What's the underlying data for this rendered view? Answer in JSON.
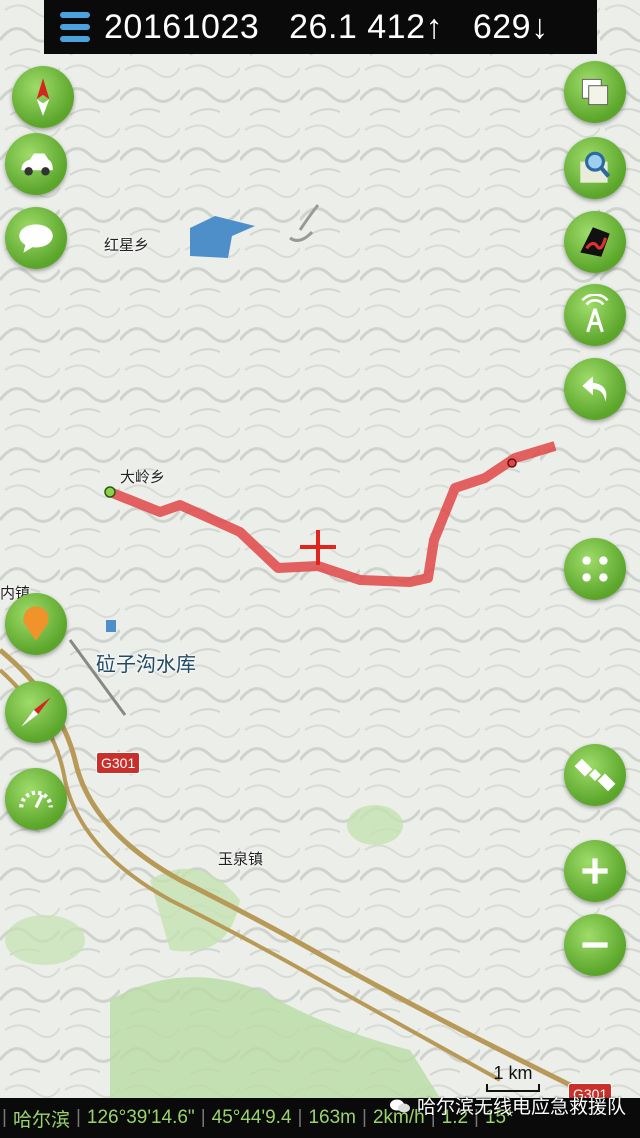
{
  "header": {
    "date": "20161023",
    "distance": "26.1",
    "ascent": "412",
    "descent": "629",
    "up_arrow": "↑",
    "down_arrow": "↓"
  },
  "map": {
    "places": {
      "hongxing": "红星乡",
      "daling": "大岭乡",
      "reservoir": "砬子沟水库",
      "yuquan": "玉泉镇",
      "left_edge_town": "内镇"
    },
    "road_g301": "G301",
    "road_g301_right": "G301",
    "scale_label": "1 km"
  },
  "controls": {
    "left": [
      "compass-icon",
      "car-icon",
      "chat-icon",
      "location-pin-icon",
      "compass-small-icon",
      "speedometer-icon"
    ],
    "right": [
      "layers-icon",
      "map-search-icon",
      "track-icon",
      "signal-tower-icon",
      "undo-icon",
      "dots-menu-icon",
      "satellite-icon",
      "zoom-in-icon",
      "zoom-out-icon"
    ]
  },
  "status": {
    "city": "哈尔滨",
    "longitude": "126°39'14.6\"",
    "latitude": "45°44'9.4",
    "altitude": "163m",
    "speed": "2km/h",
    "accuracy": "1.2",
    "satellites": "15*"
  },
  "watermark": "哈尔滨无线电应急救援队",
  "colors": {
    "accent_green": "#5aa52a",
    "track_red": "#e04848",
    "topbar_bg": "#0a0a0a"
  }
}
